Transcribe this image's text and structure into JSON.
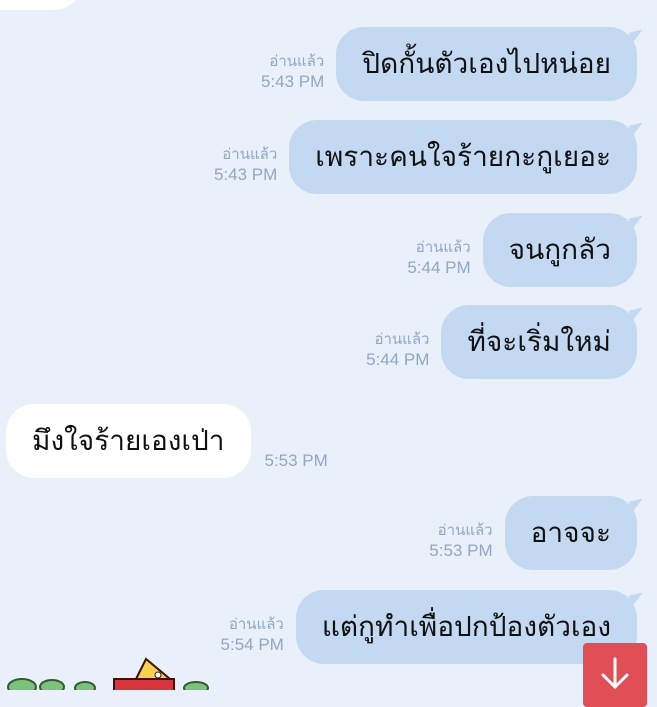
{
  "messages": [
    {
      "dir": "out",
      "text": "ปิดกั้นตัวเองไปหน่อย",
      "read": "อ่านแล้ว",
      "time": "5:43 PM"
    },
    {
      "dir": "out",
      "text": "เพราะคนใจร้ายกะกูเยอะ",
      "read": "อ่านแล้ว",
      "time": "5:43 PM"
    },
    {
      "dir": "out",
      "text": "จนกูกลัว",
      "read": "อ่านแล้ว",
      "time": "5:44 PM"
    },
    {
      "dir": "out",
      "text": "ที่จะเริ่มใหม่",
      "read": "อ่านแล้ว",
      "time": "5:44 PM"
    },
    {
      "dir": "in",
      "text": "มึงใจร้ายเองเป่า",
      "time": "5:53 PM"
    },
    {
      "dir": "out",
      "text": "อาจจะ",
      "read": "อ่านแล้ว",
      "time": "5:53 PM"
    },
    {
      "dir": "out",
      "text": "แต่กูทำเพื่อปกป้องตัวเอง",
      "read": "อ่านแล้ว",
      "time": "5:54 PM"
    }
  ],
  "scroll_button": {
    "icon": "arrow-down-icon",
    "color": "#e14e55"
  },
  "colors": {
    "background": "#e9f0f9",
    "outgoing_bubble": "#c2d9f1",
    "incoming_bubble": "#ffffff",
    "meta_text": "#8fa8c4"
  }
}
